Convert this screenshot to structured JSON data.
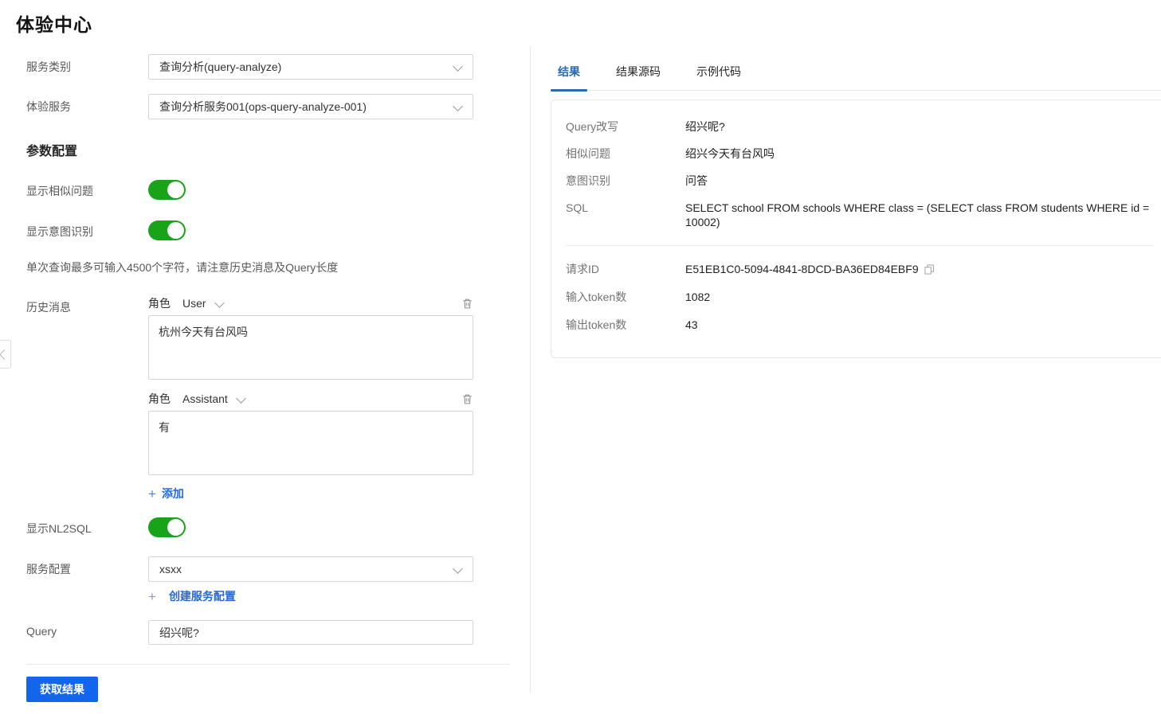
{
  "page": {
    "title": "体验中心"
  },
  "colors": {
    "accent_blue": "#1366ec",
    "link_blue": "#2468d9",
    "tab_active_blue": "#2a6bb0",
    "toggle_on_green": "#18a318"
  },
  "icons": {
    "plus_glyph": "+"
  },
  "form": {
    "service_category": {
      "label": "服务类别",
      "value": "查询分析(query-analyze)"
    },
    "experience_service": {
      "label": "体验服务",
      "value": "查询分析服务001(ops-query-analyze-001)"
    },
    "params_heading": "参数配置",
    "show_similar": {
      "label": "显示相似问题",
      "on": true
    },
    "show_intent": {
      "label": "显示意图识别",
      "on": true
    },
    "note": "单次查询最多可输入4500个字符，请注意历史消息及Query长度",
    "history": {
      "label": "历史消息",
      "role_label": "角色",
      "messages": [
        {
          "role": "User",
          "content": "杭州今天有台风吗"
        },
        {
          "role": "Assistant",
          "content": "有"
        }
      ],
      "add_label": "添加"
    },
    "show_nl2sql": {
      "label": "显示NL2SQL",
      "on": true
    },
    "service_config": {
      "label": "服务配置",
      "value": "xsxx",
      "create_label": "创建服务配置"
    },
    "query": {
      "label": "Query",
      "value": "绍兴呢?"
    },
    "submit_label": "获取结果"
  },
  "results": {
    "tabs": [
      {
        "label": "结果",
        "active": true
      },
      {
        "label": "结果源码",
        "active": false
      },
      {
        "label": "示例代码",
        "active": false
      }
    ],
    "rows": [
      {
        "label": "Query改写",
        "value": "绍兴呢?"
      },
      {
        "label": "相似问题",
        "value": "绍兴今天有台风吗"
      },
      {
        "label": "意图识别",
        "value": "问答"
      },
      {
        "label": "SQL",
        "value": "SELECT school FROM schools WHERE class = (SELECT class FROM students WHERE id = 10002)"
      }
    ],
    "meta": [
      {
        "label": "请求ID",
        "value": "E51EB1C0-5094-4841-8DCD-BA36ED84EBF9"
      },
      {
        "label": "输入token数",
        "value": "1082"
      },
      {
        "label": "输出token数",
        "value": "43"
      }
    ]
  }
}
